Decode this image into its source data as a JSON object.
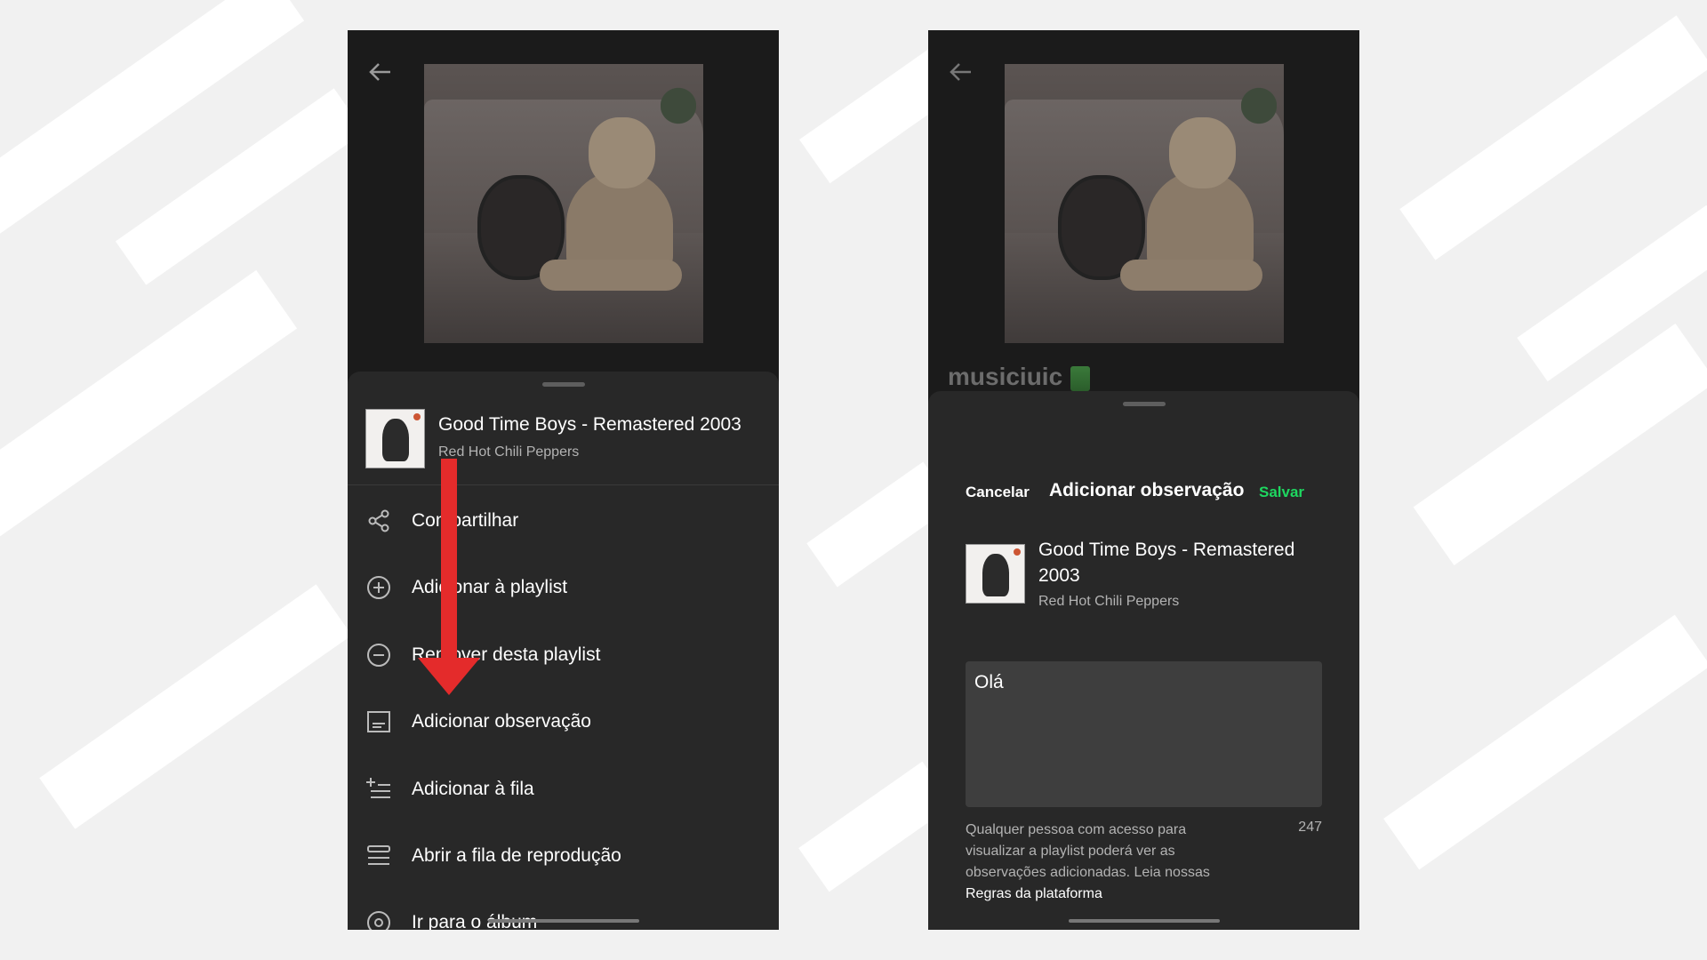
{
  "left_screen": {
    "song": {
      "title": "Good Time Boys - Remastered 2003",
      "artist": "Red Hot Chili Peppers"
    },
    "menu": [
      {
        "label": "Compartilhar",
        "icon": "share-icon"
      },
      {
        "label": "Adicionar à playlist",
        "icon": "plus-circle-icon"
      },
      {
        "label": "Remover desta playlist",
        "icon": "minus-circle-icon"
      },
      {
        "label": "Adicionar observação",
        "icon": "note-icon"
      },
      {
        "label": "Adicionar à fila",
        "icon": "queue-add-icon"
      },
      {
        "label": "Abrir a fila de reprodução",
        "icon": "queue-icon"
      },
      {
        "label": "Ir para o álbum",
        "icon": "album-icon"
      }
    ],
    "annotation_color": "#e42b2b"
  },
  "right_screen": {
    "profile_name": "musiciuic",
    "header": {
      "cancel_label": "Cancelar",
      "title": "Adicionar observação",
      "save_label": "Salvar"
    },
    "song": {
      "title": "Good Time Boys - Remastered 2003",
      "artist": "Red Hot Chili Peppers"
    },
    "note_value": "Olá",
    "disclaimer_text": "Qualquer pessoa com acesso para visualizar a playlist poderá ver as observações adicionadas. Leia nossas ",
    "disclaimer_link": "Regras da plataforma",
    "char_count": "247",
    "accent_color": "#1ed760"
  }
}
